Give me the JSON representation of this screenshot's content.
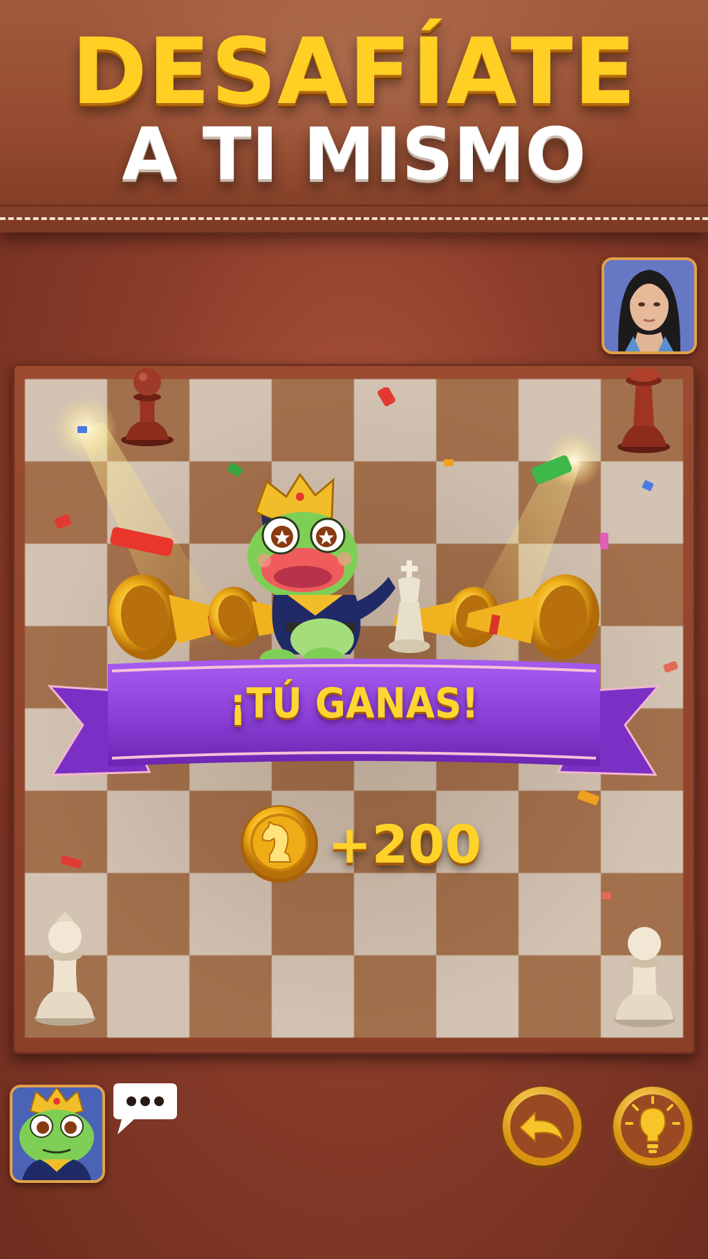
{
  "banner": {
    "line1": "DESAFÍATE",
    "line2": "A TI MISMO"
  },
  "opponent": {
    "avatar_icon": "opponent-portrait"
  },
  "player": {
    "avatar_icon": "frog-king-portrait"
  },
  "board": {
    "light_color": "#d9cbbb",
    "dark_color": "#a7744f",
    "pieces": [
      "black-pawn",
      "black-pawn",
      "white-pawn",
      "white-pawn"
    ]
  },
  "result": {
    "title": "¡TÚ GANAS!",
    "reward": "+200",
    "coin_icon": "knight-coin-icon"
  },
  "controls": {
    "chat_icon": "chat-bubble-icon",
    "undo_icon": "undo-arrow-icon",
    "hint_icon": "lightbulb-icon"
  },
  "colors": {
    "title_gold": "#ffcf24",
    "ribbon_purple": "#8b3fd6",
    "button_gold": "#f0b21e"
  }
}
